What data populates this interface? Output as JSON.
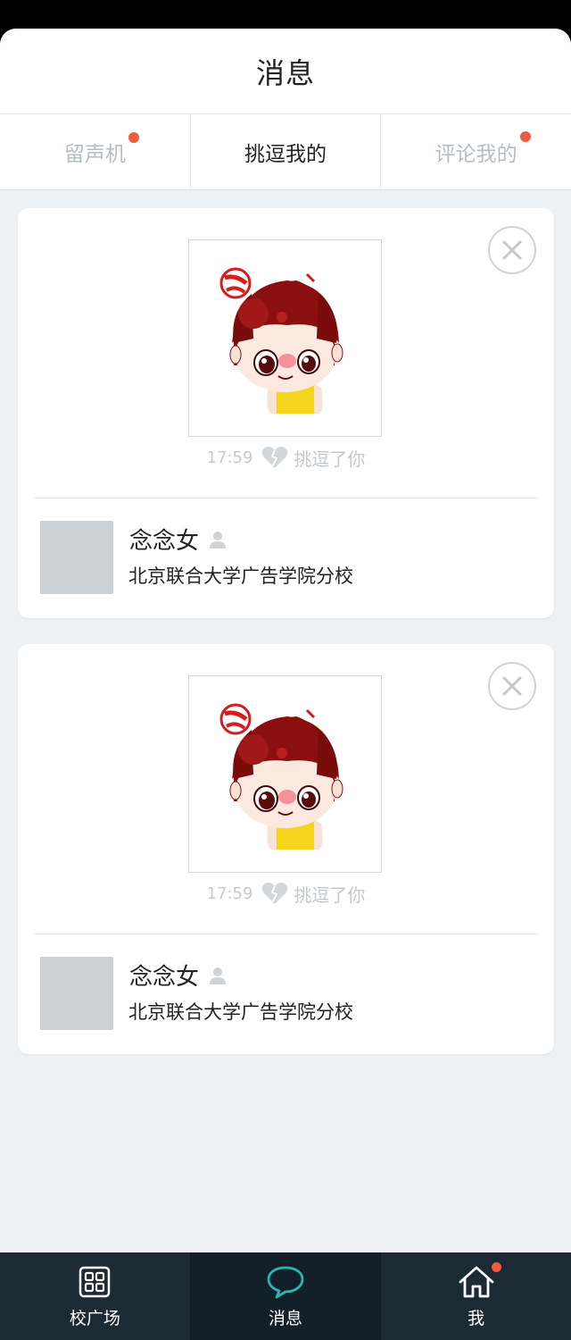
{
  "header": {
    "title": "消息"
  },
  "tabs": [
    {
      "label": "留声机",
      "active": false,
      "has_dot": true
    },
    {
      "label": "挑逗我的",
      "active": true,
      "has_dot": false
    },
    {
      "label": "评论我的",
      "active": false,
      "has_dot": true
    }
  ],
  "cards": [
    {
      "time": "17:59",
      "action": "挑逗了你",
      "sticker": "cartoon-girl-sticker",
      "user": {
        "name": "念念女",
        "school": "北京联合大学广告学院分校"
      }
    },
    {
      "time": "17:59",
      "action": "挑逗了你",
      "sticker": "cartoon-girl-sticker",
      "user": {
        "name": "念念女",
        "school": "北京联合大学广告学院分校"
      }
    }
  ],
  "bottom_nav": [
    {
      "label": "校广场",
      "icon": "grid-icon",
      "active": false,
      "has_dot": false
    },
    {
      "label": "消息",
      "icon": "chat-bubble-icon",
      "active": true,
      "has_dot": false
    },
    {
      "label": "我",
      "icon": "home-icon",
      "active": false,
      "has_dot": true
    }
  ],
  "colors": {
    "accent_dot": "#f05b3f",
    "nav_bg": "#1c2a33",
    "chat_icon": "#2fb4b6",
    "page_bg": "#eef1f3"
  }
}
